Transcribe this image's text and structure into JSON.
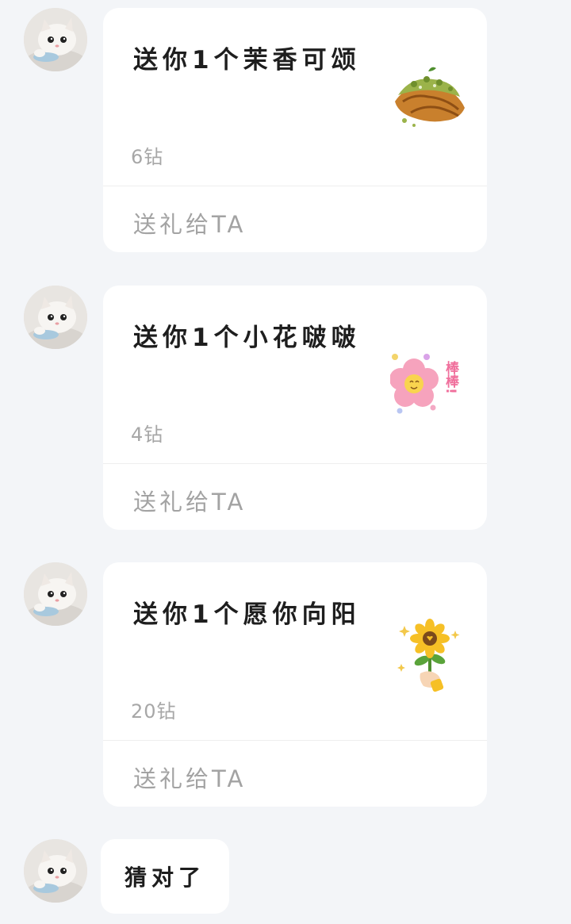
{
  "messages": [
    {
      "type": "gift",
      "title": "送你1个茉香可颂",
      "price": "6钻",
      "action": "送礼给TA",
      "art": "croissant"
    },
    {
      "type": "gift",
      "title": "送你1个小花啵啵",
      "price": "4钻",
      "action": "送礼给TA",
      "art": "pink-flower-bangbang"
    },
    {
      "type": "gift",
      "title": "送你1个愿你向阳",
      "price": "20钻",
      "action": "送礼给TA",
      "art": "sunflower-hand"
    },
    {
      "type": "text",
      "text": "猜对了"
    }
  ],
  "gift_art_text": {
    "flower_badge": "棒棒!"
  },
  "avatar_icon": "kitten-avatar"
}
